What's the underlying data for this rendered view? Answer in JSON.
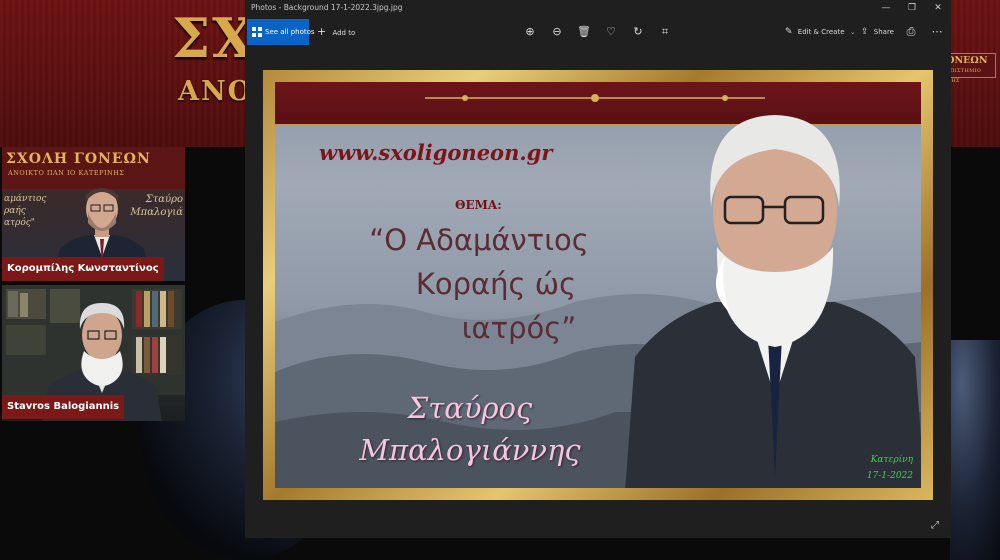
{
  "stage": {
    "title": "ΣΧ",
    "subtitle": "ΑΝΟ",
    "badge_title": "ΣΧΟΛΗ ΓΟΝΕΩΝ",
    "badge_sub": "ΑΝΟΙΧΤΟ ΠΑΝΕΠΙΣΤΗΜΙΟ ΚΑΤΕΡΙΝΗΣ"
  },
  "participants": [
    {
      "name": "Κορομπίλης Κωνσταντίνος",
      "banner_title": "ΣΧΟΛΗ ΓΟΝΕΩΝ",
      "banner_sub": "ΑΝΟΙΚΤΟ ΠΑΝ ΙΟ ΚΑΤΕΡΙΝΗΣ",
      "left_text": [
        "αμάντιος",
        "ραής",
        "ατρός\""
      ],
      "right_text": [
        "Σταύρο",
        "Μπαλογιά"
      ]
    },
    {
      "name": "Stavros Balogiannis"
    }
  ],
  "window": {
    "title": "Photos - Background 17-1-2022.3jpg.jpg",
    "toolbar": {
      "see_all": "See all photos",
      "add_to": "Add to",
      "edit_create": "Edit & Create",
      "share": "Share"
    },
    "icons": [
      "zoom-in-icon",
      "zoom-out-icon",
      "delete-icon",
      "favorite-icon",
      "rotate-icon",
      "crop-icon",
      "print-icon",
      "more-icon"
    ]
  },
  "photo": {
    "website": "www.sxoligoneon.gr",
    "thema_label": "ΘΕΜΑ:",
    "topic_lines": [
      "“Ο Αδαμάντιος",
      "Κοραής ώς",
      "ιατρός”"
    ],
    "speaker_lines": [
      "Σταύρος",
      "Μπαλογιάννης"
    ],
    "place": "Κατερίνη",
    "date": "17-1-2022"
  }
}
